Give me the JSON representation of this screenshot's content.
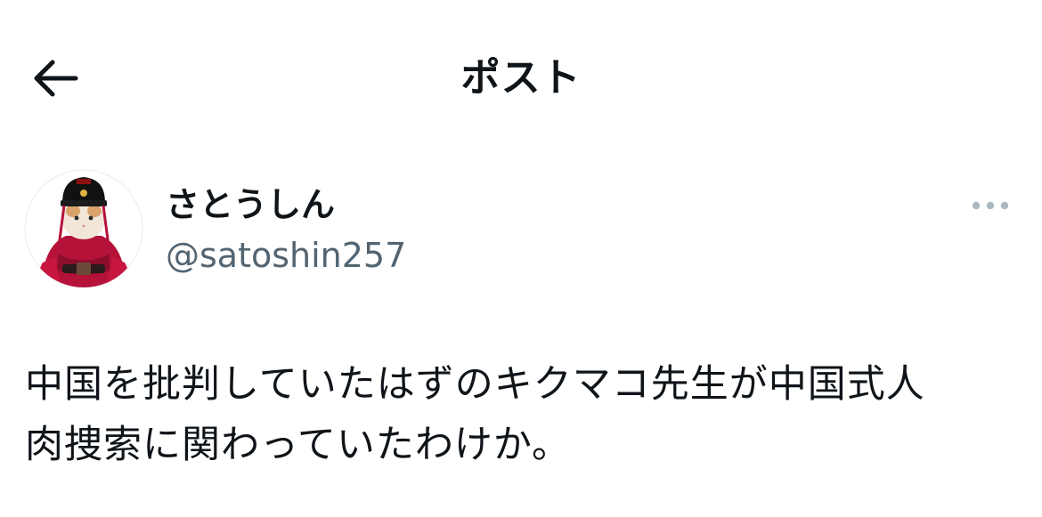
{
  "header": {
    "title": "ポスト",
    "back_icon": "arrow-left-icon"
  },
  "author": {
    "display_name": "さとうしん",
    "handle": "@satoshin257",
    "avatar": "cat-in-red-costume-avatar",
    "more_icon": "more-horizontal-icon"
  },
  "post": {
    "line1": "中国を批判していたはずのキクマコ先生が中国式人",
    "line2": "肉捜索に関わっていたわけか。"
  },
  "colors": {
    "text_primary": "#0f1419",
    "text_secondary": "#536471",
    "icon_muted": "#aab8c2",
    "background": "#ffffff"
  }
}
